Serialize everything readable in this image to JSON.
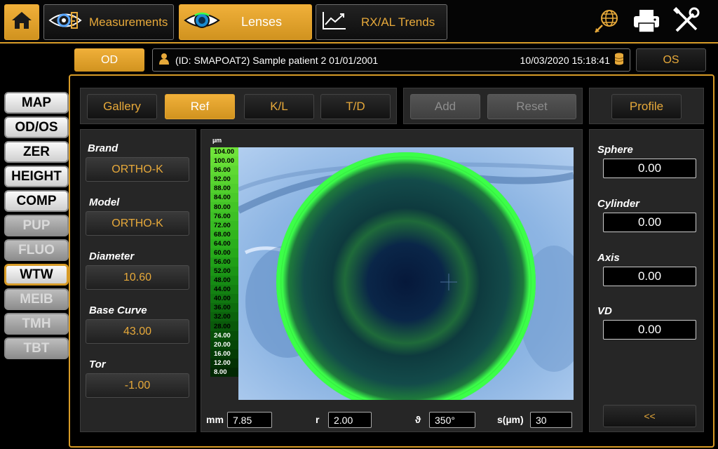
{
  "header": {
    "tabs": [
      {
        "label": "Measurements"
      },
      {
        "label": "Lenses"
      },
      {
        "label": "RX/AL Trends"
      }
    ]
  },
  "patient_bar": {
    "od_label": "OD",
    "os_label": "OS",
    "patient_text": "(ID: SMAPOAT2) Sample patient 2 01/01/2001",
    "datetime": "10/03/2020 15:18:41"
  },
  "side_menu": [
    {
      "label": "MAP",
      "state": "enabled"
    },
    {
      "label": "OD/OS",
      "state": "enabled"
    },
    {
      "label": "ZER",
      "state": "enabled"
    },
    {
      "label": "HEIGHT",
      "state": "enabled"
    },
    {
      "label": "COMP",
      "state": "enabled"
    },
    {
      "label": "PUP",
      "state": "disabled"
    },
    {
      "label": "FLUO",
      "state": "disabled"
    },
    {
      "label": "WTW",
      "state": "selected"
    },
    {
      "label": "MEIB",
      "state": "disabled"
    },
    {
      "label": "TMH",
      "state": "disabled"
    },
    {
      "label": "TBT",
      "state": "disabled"
    }
  ],
  "toolbar": {
    "gallery": "Gallery",
    "ref": "Ref",
    "kl": "K/L",
    "td": "T/D",
    "add": "Add",
    "reset": "Reset",
    "profile": "Profile"
  },
  "lens": {
    "brand_label": "Brand",
    "brand_value": "ORTHO-K",
    "model_label": "Model",
    "model_value": "ORTHO-K",
    "diameter_label": "Diameter",
    "diameter_value": "10.60",
    "base_curve_label": "Base Curve",
    "base_curve_value": "43.00",
    "tor_label": "Tor",
    "tor_value": "-1.00"
  },
  "rx": {
    "sphere_label": "Sphere",
    "sphere_value": "0.00",
    "cylinder_label": "Cylinder",
    "cylinder_value": "0.00",
    "axis_label": "Axis",
    "axis_value": "0.00",
    "vd_label": "VD",
    "vd_value": "0.00",
    "back_button": "<<"
  },
  "scale": {
    "unit": "µm",
    "ticks": [
      "104.00",
      "100.00",
      "96.00",
      "92.00",
      "88.00",
      "84.00",
      "80.00",
      "76.00",
      "72.00",
      "68.00",
      "64.00",
      "60.00",
      "56.00",
      "52.00",
      "48.00",
      "44.00",
      "40.00",
      "36.00",
      "32.00",
      "28.00",
      "24.00",
      "20.00",
      "16.00",
      "12.00",
      "8.00"
    ],
    "colors": [
      "#6fe33a",
      "#67de36",
      "#5fd933",
      "#58d430",
      "#51cf2d",
      "#4aca2a",
      "#43c527",
      "#3dc025",
      "#37bb22",
      "#31b51f",
      "#2baf1d",
      "#26a91a",
      "#209f18",
      "#1b9516",
      "#168b14",
      "#138112",
      "#107710",
      "#0d6d0e",
      "#0b630c",
      "#09590a",
      "#074f08",
      "#054507",
      "#043b05",
      "#033104",
      "#022803"
    ]
  },
  "image_controls": {
    "mm_label": "mm",
    "mm_value": "7.85",
    "r_label": "r",
    "r_value": "2.00",
    "theta_label": "ϑ",
    "theta_value": "350°",
    "s_label": "s(µm)",
    "s_value": "30"
  },
  "colors": {
    "accent": "#d79b27",
    "lens_ring": "#27ff3a",
    "iris": "#6a9ad0"
  }
}
